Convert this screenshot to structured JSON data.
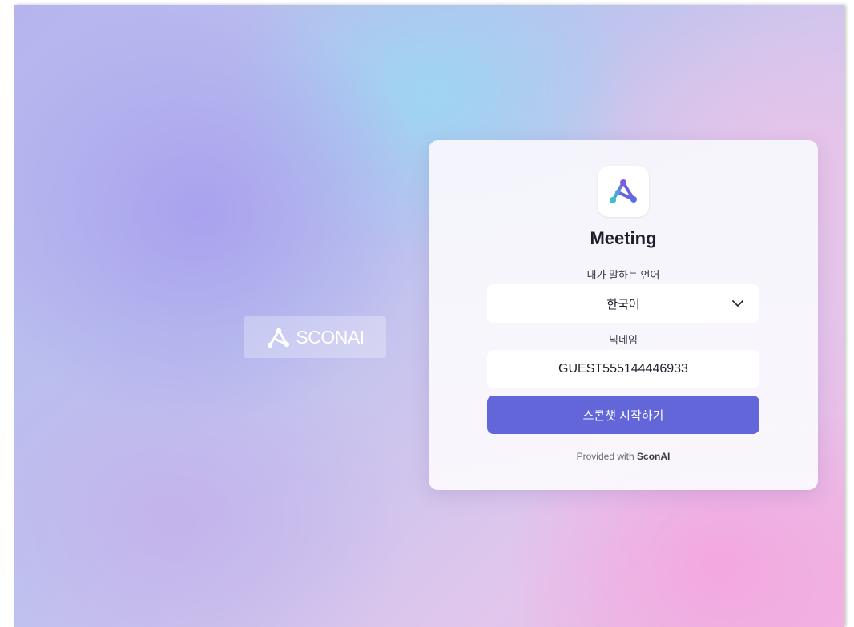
{
  "brand": {
    "name": "SCONAI",
    "logo_icon": "scon-logo-icon"
  },
  "card": {
    "app_icon": "scon-app-icon",
    "title": "Meeting",
    "language_label": "내가 말하는 언어",
    "language_value": "한국어",
    "nickname_label": "닉네임",
    "nickname_value": "GUEST555144446933",
    "start_button": "스콘챗 시작하기",
    "footer_prefix": "Provided with",
    "footer_brand": "SconAI"
  },
  "colors": {
    "button": "#6366d9",
    "logo_purple": "#7a5ee0",
    "logo_teal": "#3bc1c6"
  }
}
